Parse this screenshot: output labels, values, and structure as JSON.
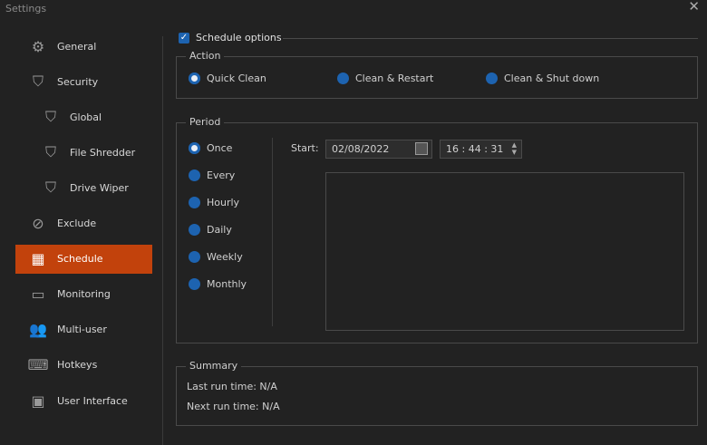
{
  "window": {
    "title": "Settings",
    "close": "✕"
  },
  "sidebar": {
    "items": [
      {
        "label": "General",
        "icon": "gear-icon"
      },
      {
        "label": "Security",
        "icon": "shield-icon"
      },
      {
        "label": "Global",
        "icon": "shield-globe-icon"
      },
      {
        "label": "File Shredder",
        "icon": "shield-file-icon"
      },
      {
        "label": "Drive Wiper",
        "icon": "shield-drive-icon"
      },
      {
        "label": "Exclude",
        "icon": "exclude-icon"
      },
      {
        "label": "Schedule",
        "icon": "calendar-clock-icon"
      },
      {
        "label": "Monitoring",
        "icon": "monitor-icon"
      },
      {
        "label": "Multi-user",
        "icon": "users-icon"
      },
      {
        "label": "Hotkeys",
        "icon": "keyboard-icon"
      },
      {
        "label": "User Interface",
        "icon": "ui-icon"
      }
    ],
    "selected": "Schedule"
  },
  "schedule": {
    "enabled_label": "Schedule options",
    "enabled": true
  },
  "action": {
    "legend": "Action",
    "options": [
      "Quick Clean",
      "Clean & Restart",
      "Clean & Shut down"
    ],
    "selected": "Quick Clean"
  },
  "period": {
    "legend": "Period",
    "options": [
      "Once",
      "Every",
      "Hourly",
      "Daily",
      "Weekly",
      "Monthly"
    ],
    "selected": "Once",
    "start_label": "Start:",
    "date": "02/08/2022",
    "time": "16 : 44 : 31"
  },
  "summary": {
    "legend": "Summary",
    "last_run": "Last run time: N/A",
    "next_run": "Next run time: N/A"
  },
  "colors": {
    "accent": "#c2420c",
    "radio": "#1d63b0"
  }
}
